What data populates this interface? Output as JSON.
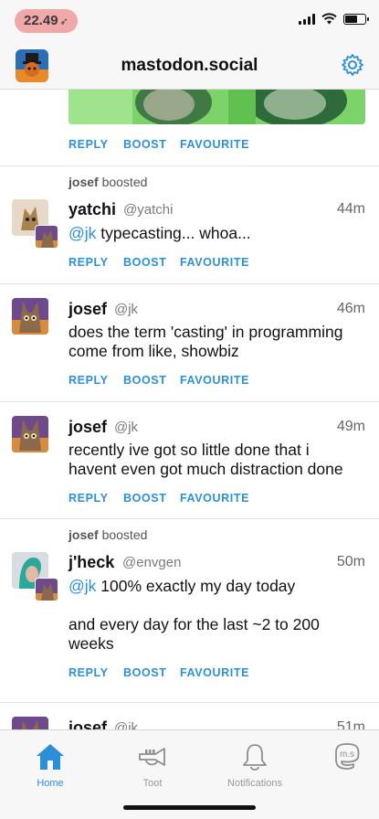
{
  "status": {
    "time": "22.49",
    "location_icon": "location-arrow-icon"
  },
  "nav": {
    "title": "mastodon.social",
    "settings_icon": "gear-icon"
  },
  "actions": {
    "reply": "REPLY",
    "boost": "BOOST",
    "favourite": "FAVOURITE"
  },
  "posts": [
    {
      "boosted_by": "josef",
      "boosted_label": "boosted",
      "name": "yatchi",
      "handle": "@yatchi",
      "time": "44m",
      "mention": "@jk",
      "text": " typecasting... whoa..."
    },
    {
      "name": "josef",
      "handle": "@jk",
      "time": "46m",
      "text": "does the term 'casting' in programming come from like, showbiz"
    },
    {
      "name": "josef",
      "handle": "@jk",
      "time": "49m",
      "text": "recently ive got so little done that i havent even got much distraction done"
    },
    {
      "boosted_by": "josef",
      "boosted_label": "boosted",
      "name": "j'heck",
      "handle": "@envgen",
      "time": "50m",
      "mention": "@jk",
      "text": " 100% exactly my day today",
      "text2": "and every day for the last ~2 to 200 weeks"
    },
    {
      "name": "josef",
      "handle": "@jk",
      "time": "51m"
    }
  ],
  "tabs": [
    {
      "label": "Home",
      "icon": "home-icon",
      "active": true
    },
    {
      "label": "Toot",
      "icon": "trumpet-icon",
      "active": false
    },
    {
      "label": "Notifications",
      "icon": "bell-icon",
      "active": false
    },
    {
      "label": "",
      "icon": "mastodon-logo-icon",
      "active": false
    }
  ],
  "colors": {
    "accent": "#2b90d9",
    "background": "#ffffff",
    "bar": "#f7f7f7"
  }
}
